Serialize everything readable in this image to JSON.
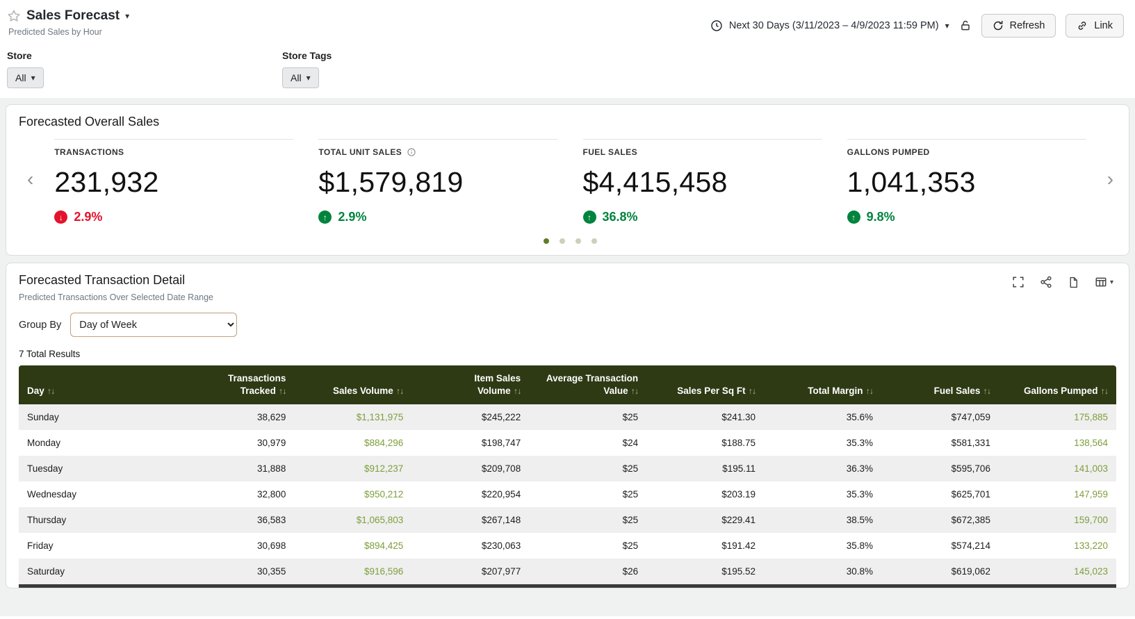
{
  "header": {
    "title": "Sales Forecast",
    "subtitle": "Predicted Sales by Hour",
    "date_selector": "Next 30 Days (3/11/2023 – 4/9/2023 11:59 PM)",
    "refresh": "Refresh",
    "link": "Link"
  },
  "filters": {
    "store_label": "Store",
    "store_value": "All",
    "store_tags_label": "Store Tags",
    "store_tags_value": "All"
  },
  "overview": {
    "title": "Forecasted Overall Sales",
    "kpis": [
      {
        "label": "TRANSACTIONS",
        "value": "231,932",
        "delta": "2.9%",
        "direction": "down"
      },
      {
        "label": "TOTAL UNIT SALES",
        "value": "$1,579,819",
        "delta": "2.9%",
        "direction": "up"
      },
      {
        "label": "FUEL SALES",
        "value": "$4,415,458",
        "delta": "36.8%",
        "direction": "up"
      },
      {
        "label": "GALLONS PUMPED",
        "value": "1,041,353",
        "delta": "9.8%",
        "direction": "up"
      }
    ],
    "dot_count": 4,
    "active_dot": 1
  },
  "detail": {
    "title": "Forecasted Transaction Detail",
    "subtitle": "Predicted Transactions Over Selected Date Range",
    "group_by_label": "Group By",
    "group_by_value": "Day of Week",
    "results_text": "7 Total Results",
    "columns": [
      "Day",
      "Transactions\nTracked",
      "Sales Volume",
      "Item Sales\nVolume",
      "Average Transaction\nValue",
      "Sales Per Sq Ft",
      "Total Margin",
      "Fuel Sales",
      "Gallons Pumped"
    ],
    "rows": [
      {
        "day": "Sunday",
        "transactions": "38,629",
        "sales_volume": "$1,131,975",
        "item_sales": "$245,222",
        "avg_transaction": "$25",
        "sales_per_sqft": "$241.30",
        "total_margin": "35.6%",
        "fuel_sales": "$747,059",
        "gallons": "175,885"
      },
      {
        "day": "Monday",
        "transactions": "30,979",
        "sales_volume": "$884,296",
        "item_sales": "$198,747",
        "avg_transaction": "$24",
        "sales_per_sqft": "$188.75",
        "total_margin": "35.3%",
        "fuel_sales": "$581,331",
        "gallons": "138,564"
      },
      {
        "day": "Tuesday",
        "transactions": "31,888",
        "sales_volume": "$912,237",
        "item_sales": "$209,708",
        "avg_transaction": "$25",
        "sales_per_sqft": "$195.11",
        "total_margin": "36.3%",
        "fuel_sales": "$595,706",
        "gallons": "141,003"
      },
      {
        "day": "Wednesday",
        "transactions": "32,800",
        "sales_volume": "$950,212",
        "item_sales": "$220,954",
        "avg_transaction": "$25",
        "sales_per_sqft": "$203.19",
        "total_margin": "35.3%",
        "fuel_sales": "$625,701",
        "gallons": "147,959"
      },
      {
        "day": "Thursday",
        "transactions": "36,583",
        "sales_volume": "$1,065,803",
        "item_sales": "$267,148",
        "avg_transaction": "$25",
        "sales_per_sqft": "$229.41",
        "total_margin": "38.5%",
        "fuel_sales": "$672,385",
        "gallons": "159,700"
      },
      {
        "day": "Friday",
        "transactions": "30,698",
        "sales_volume": "$894,425",
        "item_sales": "$230,063",
        "avg_transaction": "$25",
        "sales_per_sqft": "$191.42",
        "total_margin": "35.8%",
        "fuel_sales": "$574,214",
        "gallons": "133,220"
      },
      {
        "day": "Saturday",
        "transactions": "30,355",
        "sales_volume": "$916,596",
        "item_sales": "$207,977",
        "avg_transaction": "$26",
        "sales_per_sqft": "$195.52",
        "total_margin": "30.8%",
        "fuel_sales": "$619,062",
        "gallons": "145,023"
      }
    ]
  },
  "icons": {
    "caret_down": "▾",
    "sort": "↑↓",
    "prev": "‹",
    "next": "›",
    "up_arrow": "↑",
    "down_arrow": "↓"
  },
  "colors": {
    "table_header_bg": "#2d3a14",
    "accent_olive": "#7d9e3c",
    "delta_up": "#00843d",
    "delta_down": "#e4132d",
    "active_dot": "#5f7d2a"
  }
}
